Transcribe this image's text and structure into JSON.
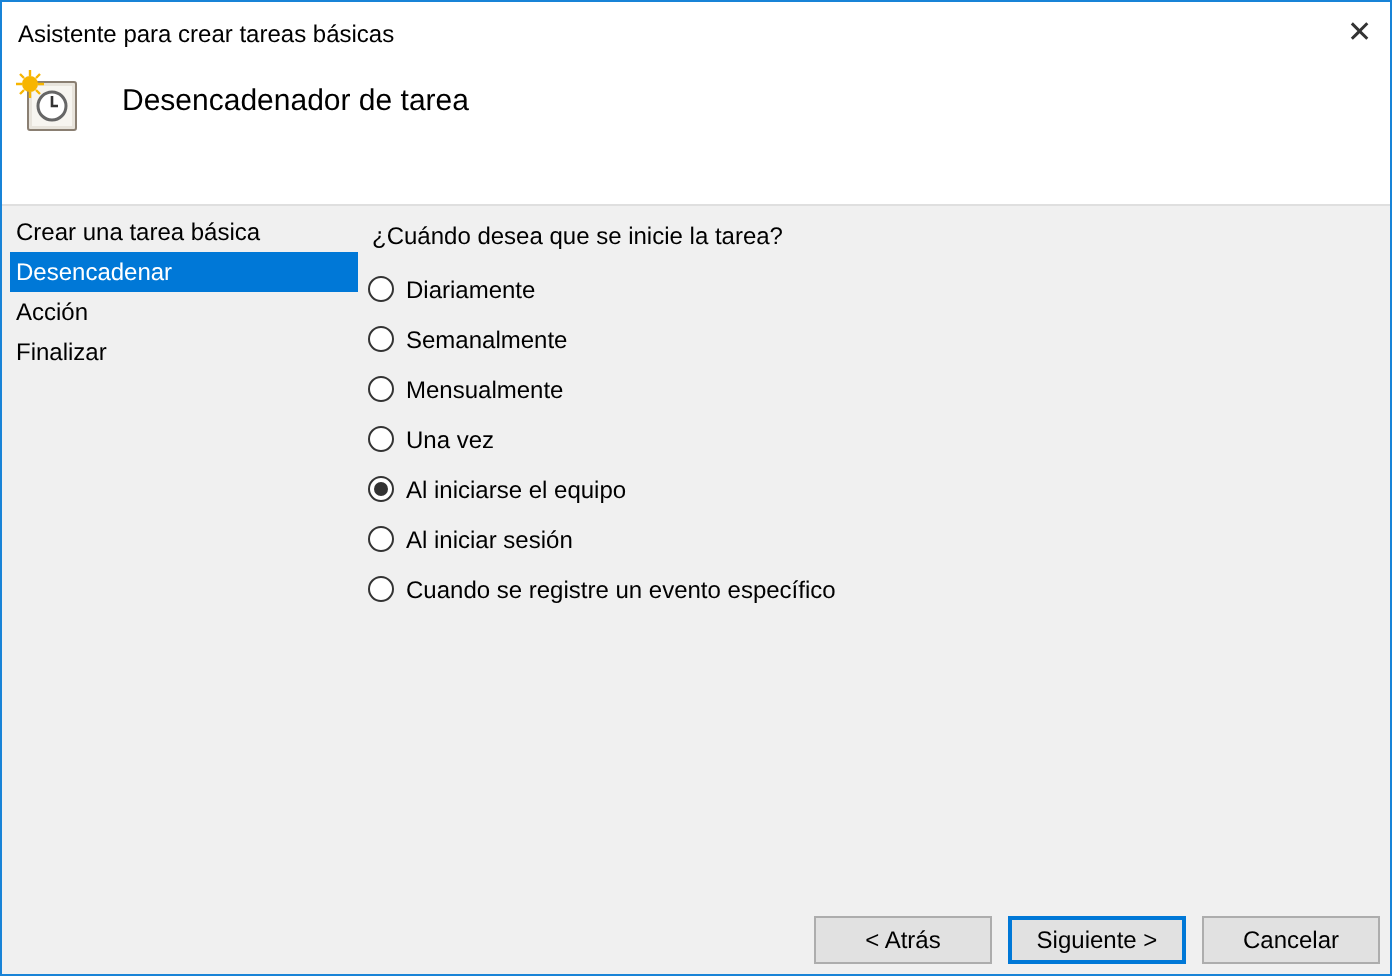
{
  "window": {
    "title": "Asistente para crear tareas básicas",
    "close": "✕"
  },
  "header": {
    "title": "Desencadenador de tarea"
  },
  "steps": [
    {
      "label": "Crear una tarea básica",
      "selected": false
    },
    {
      "label": "Desencadenar",
      "selected": true
    },
    {
      "label": "Acción",
      "selected": false
    },
    {
      "label": "Finalizar",
      "selected": false
    }
  ],
  "question": "¿Cuándo desea que se inicie la tarea?",
  "options": [
    {
      "label": "Diariamente",
      "selected": false
    },
    {
      "label": "Semanalmente",
      "selected": false
    },
    {
      "label": "Mensualmente",
      "selected": false
    },
    {
      "label": "Una vez",
      "selected": false
    },
    {
      "label": "Al iniciarse el equipo",
      "selected": true
    },
    {
      "label": "Al iniciar sesión",
      "selected": false
    },
    {
      "label": "Cuando se registre un evento específico",
      "selected": false
    }
  ],
  "buttons": [
    {
      "label": "< Atrás",
      "default": false
    },
    {
      "label": "Siguiente >",
      "default": true
    },
    {
      "label": "Cancelar",
      "default": false
    }
  ]
}
